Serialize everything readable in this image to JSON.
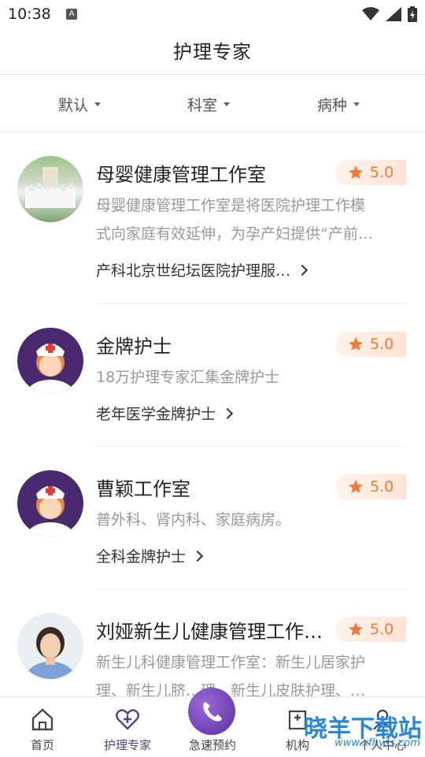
{
  "status_bar": {
    "time": "10:38",
    "notification_glyph": "A"
  },
  "header": {
    "title": "护理专家"
  },
  "filters": [
    {
      "label": "默认"
    },
    {
      "label": "科室"
    },
    {
      "label": "病种"
    }
  ],
  "experts": [
    {
      "name": "母婴健康管理工作室",
      "rating": "5.0",
      "desc_lines": [
        "母婴健康管理工作室是将医院护理工作模",
        "式向家庭有效延伸，为孕产妇提供“产前…"
      ],
      "tag": "产科北京世纪坛医院护理服…",
      "avatar_icon": "group-photo-icon"
    },
    {
      "name": "金牌护士",
      "rating": "5.0",
      "desc_lines": [
        "18万护理专家汇集金牌护士"
      ],
      "tag": "老年医学金牌护士",
      "avatar_icon": "nurse-avatar-icon"
    },
    {
      "name": "曹颖工作室",
      "rating": "5.0",
      "desc_lines": [
        "普外科、肾内科、家庭病房。"
      ],
      "tag": "全科金牌护士",
      "avatar_icon": "nurse-avatar-icon"
    },
    {
      "name": "刘娅新生儿健康管理工作…",
      "rating": "5.0",
      "desc_lines": [
        "新生儿科健康管理工作室：新生儿居家护",
        "理、新生儿脐…理、新生儿皮肤护理、…"
      ],
      "tag": "",
      "avatar_icon": "portrait-avatar-icon"
    }
  ],
  "tabbar": {
    "items": [
      {
        "label": "首页",
        "icon": "home-icon"
      },
      {
        "label": "护理专家",
        "icon": "heart-plus-icon"
      },
      {
        "label": "急速预约",
        "icon": "phone-icon"
      },
      {
        "label": "机构",
        "icon": "hospital-icon"
      },
      {
        "label": "个人中心",
        "icon": "user-icon"
      }
    ]
  },
  "watermark": {
    "text": "晓羊下载站",
    "url": "www.xfhyss.com"
  },
  "colors": {
    "accent": "#5a3d8a",
    "rating": "#f07a3a"
  }
}
